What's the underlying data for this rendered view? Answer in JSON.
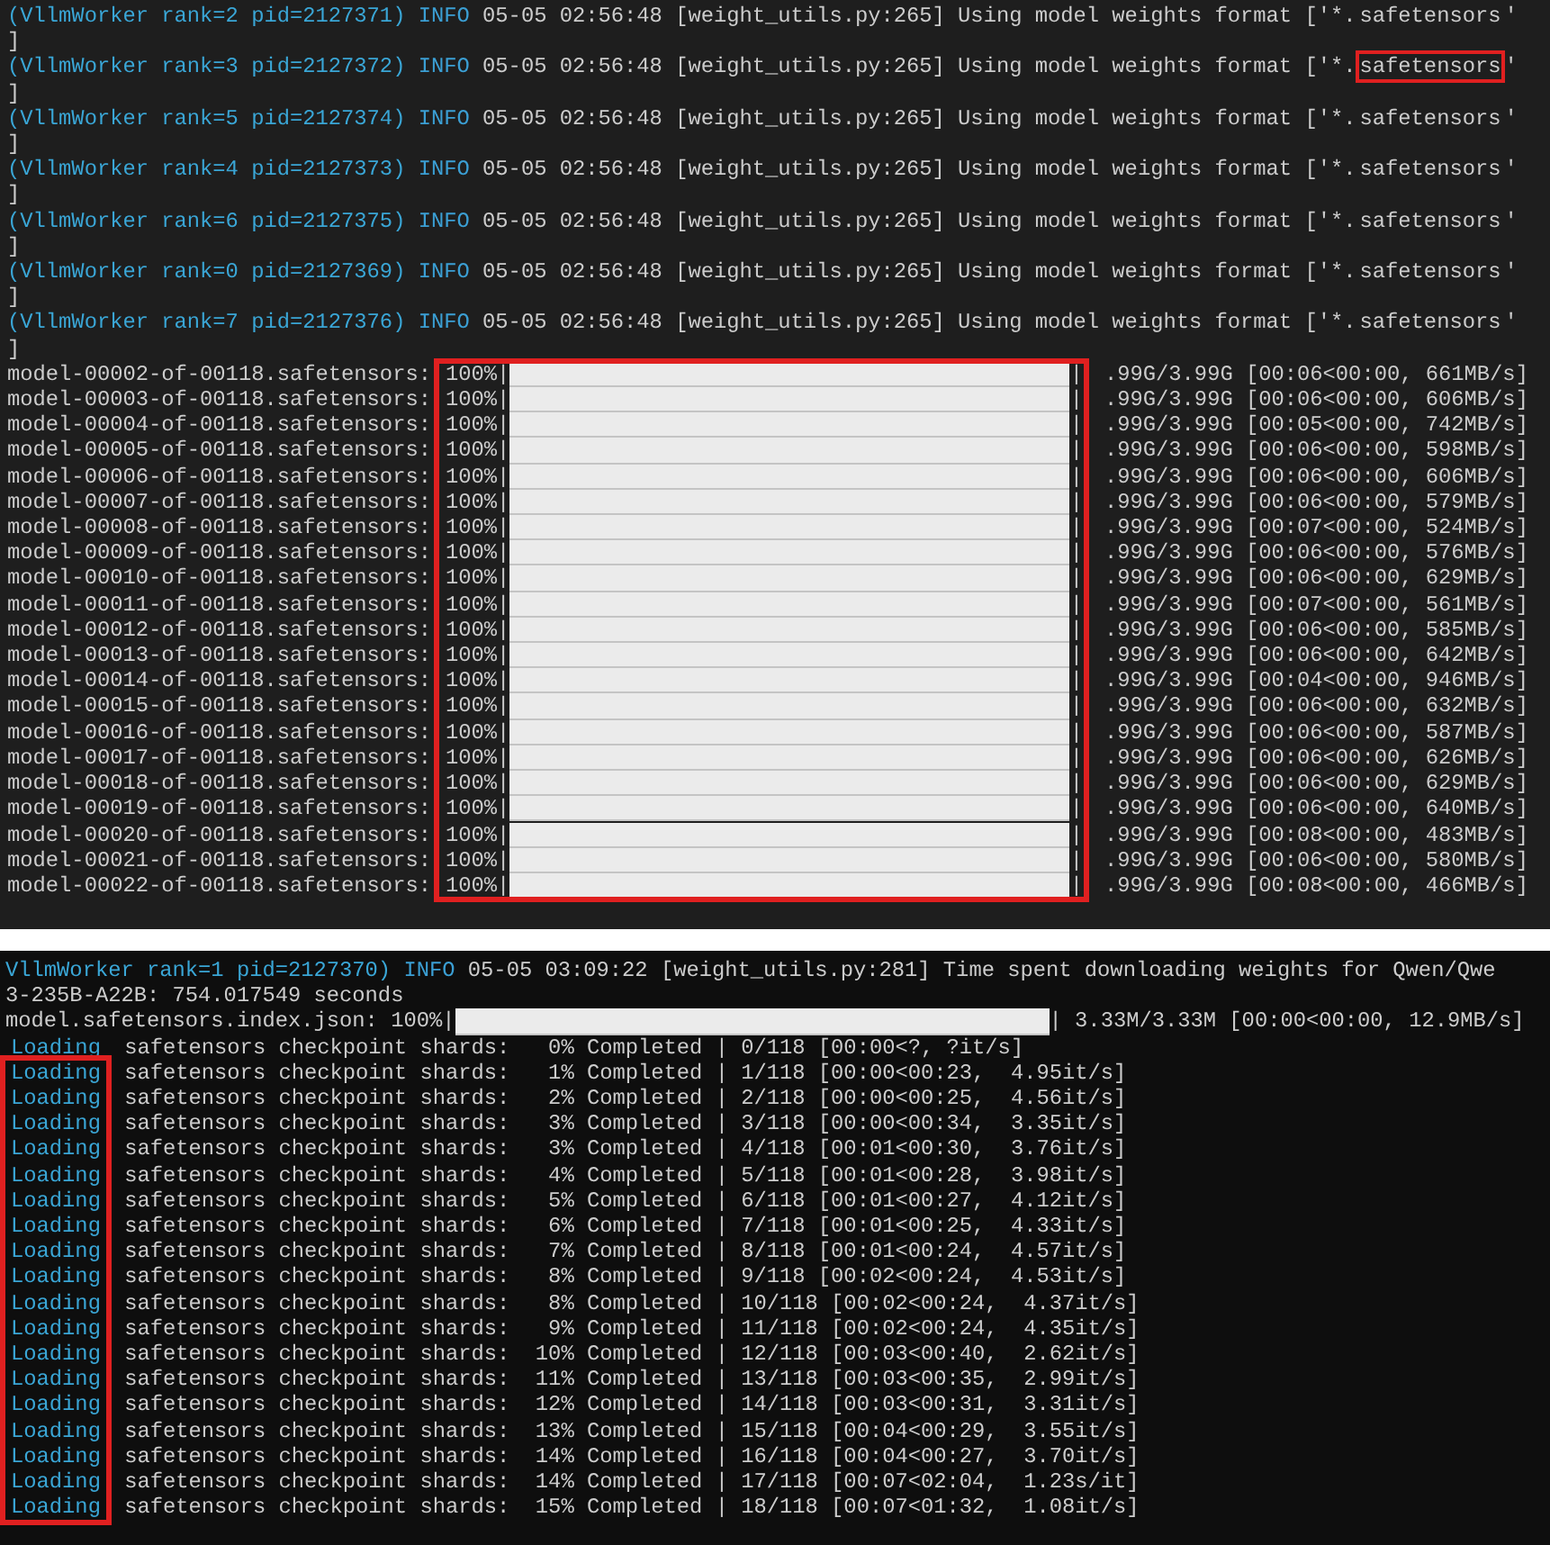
{
  "top_panel": {
    "log_lines": [
      {
        "worker": "(VllmWorker rank=2 pid=2127371)",
        "level": "INFO",
        "message": "05-05 02:56:48 [weight_utils.py:265] Using model weights format ['*.",
        "pattern": "safetensors",
        "tail": "'",
        "highlighted": false,
        "continuation": "]"
      },
      {
        "worker": "(VllmWorker rank=3 pid=2127372)",
        "level": "INFO",
        "message": "05-05 02:56:48 [weight_utils.py:265] Using model weights format ['*.",
        "pattern": "safetensors",
        "tail": "'",
        "highlighted": true,
        "continuation": "]"
      },
      {
        "worker": "(VllmWorker rank=5 pid=2127374)",
        "level": "INFO",
        "message": "05-05 02:56:48 [weight_utils.py:265] Using model weights format ['*.",
        "pattern": "safetensors",
        "tail": "'",
        "highlighted": false,
        "continuation": "]"
      },
      {
        "worker": "(VllmWorker rank=4 pid=2127373)",
        "level": "INFO",
        "message": "05-05 02:56:48 [weight_utils.py:265] Using model weights format ['*.",
        "pattern": "safetensors",
        "tail": "'",
        "highlighted": false,
        "continuation": "]"
      },
      {
        "worker": "(VllmWorker rank=6 pid=2127375)",
        "level": "INFO",
        "message": "05-05 02:56:48 [weight_utils.py:265] Using model weights format ['*.",
        "pattern": "safetensors",
        "tail": "'",
        "highlighted": false,
        "continuation": "]"
      },
      {
        "worker": "(VllmWorker rank=0 pid=2127369)",
        "level": "INFO",
        "message": "05-05 02:56:48 [weight_utils.py:265] Using model weights format ['*.",
        "pattern": "safetensors",
        "tail": "'",
        "highlighted": false,
        "continuation": "]"
      },
      {
        "worker": "(VllmWorker rank=7 pid=2127376)",
        "level": "INFO",
        "message": "05-05 02:56:48 [weight_utils.py:265] Using model weights format ['*.",
        "pattern": "safetensors",
        "tail": "'",
        "highlighted": false,
        "continuation": "]"
      }
    ],
    "downloads_highlighted": true,
    "downloads": [
      {
        "file": "model-00002-of-00118.safetensors:",
        "percent": "100%|",
        "level": 1,
        "end": "|",
        "stats": ".99G/3.99G [00:06<00:00, 661MB/s]"
      },
      {
        "file": "model-00003-of-00118.safetensors:",
        "percent": "100%|",
        "level": 1,
        "end": "|",
        "stats": ".99G/3.99G [00:06<00:00, 606MB/s]"
      },
      {
        "file": "model-00004-of-00118.safetensors:",
        "percent": "100%|",
        "level": 1,
        "end": "|",
        "stats": ".99G/3.99G [00:05<00:00, 742MB/s]"
      },
      {
        "file": "model-00005-of-00118.safetensors:",
        "percent": "100%|",
        "level": 1,
        "end": "|",
        "stats": ".99G/3.99G [00:06<00:00, 598MB/s]"
      },
      {
        "file": "model-00006-of-00118.safetensors:",
        "percent": "100%|",
        "level": 1,
        "end": "|",
        "stats": ".99G/3.99G [00:06<00:00, 606MB/s]"
      },
      {
        "file": "model-00007-of-00118.safetensors:",
        "percent": "100%|",
        "level": 1,
        "end": "|",
        "stats": ".99G/3.99G [00:06<00:00, 579MB/s]"
      },
      {
        "file": "model-00008-of-00118.safetensors:",
        "percent": "100%|",
        "level": 1,
        "end": "|",
        "stats": ".99G/3.99G [00:07<00:00, 524MB/s]"
      },
      {
        "file": "model-00009-of-00118.safetensors:",
        "percent": "100%|",
        "level": 1,
        "end": "|",
        "stats": ".99G/3.99G [00:06<00:00, 576MB/s]"
      },
      {
        "file": "model-00010-of-00118.safetensors:",
        "percent": "100%|",
        "level": 1,
        "end": "|",
        "stats": ".99G/3.99G [00:06<00:00, 629MB/s]"
      },
      {
        "file": "model-00011-of-00118.safetensors:",
        "percent": "100%|",
        "level": 1,
        "end": "|",
        "stats": ".99G/3.99G [00:07<00:00, 561MB/s]"
      },
      {
        "file": "model-00012-of-00118.safetensors:",
        "percent": "100%|",
        "level": 1,
        "end": "|",
        "stats": ".99G/3.99G [00:06<00:00, 585MB/s]"
      },
      {
        "file": "model-00013-of-00118.safetensors:",
        "percent": "100%|",
        "level": 1,
        "end": "|",
        "stats": ".99G/3.99G [00:06<00:00, 642MB/s]"
      },
      {
        "file": "model-00014-of-00118.safetensors:",
        "percent": "100%|",
        "level": 1,
        "end": "|",
        "stats": ".99G/3.99G [00:04<00:00, 946MB/s]"
      },
      {
        "file": "model-00015-of-00118.safetensors:",
        "percent": "100%|",
        "level": 1,
        "end": "|",
        "stats": ".99G/3.99G [00:06<00:00, 632MB/s]"
      },
      {
        "file": "model-00016-of-00118.safetensors:",
        "percent": "100%|",
        "level": 1,
        "end": "|",
        "stats": ".99G/3.99G [00:06<00:00, 587MB/s]"
      },
      {
        "file": "model-00017-of-00118.safetensors:",
        "percent": "100%|",
        "level": 1,
        "end": "|",
        "stats": ".99G/3.99G [00:06<00:00, 626MB/s]"
      },
      {
        "file": "model-00018-of-00118.safetensors:",
        "percent": "100%|",
        "level": 1,
        "end": "|",
        "stats": ".99G/3.99G [00:06<00:00, 629MB/s]"
      },
      {
        "file": "model-00019-of-00118.safetensors:",
        "percent": "100%|",
        "level": 1,
        "end": "|",
        "stats": ".99G/3.99G [00:06<00:00, 640MB/s]"
      },
      {
        "file": "model-00020-of-00118.safetensors:",
        "percent": "100%|",
        "level": 1,
        "end": "|",
        "stats": ".99G/3.99G [00:08<00:00, 483MB/s]"
      },
      {
        "file": "model-00021-of-00118.safetensors:",
        "percent": "100%|",
        "level": 1,
        "end": "|",
        "stats": ".99G/3.99G [00:06<00:00, 580MB/s]"
      },
      {
        "file": "model-00022-of-00118.safetensors:",
        "percent": "100%|",
        "level": 1,
        "end": "|",
        "stats": ".99G/3.99G [00:08<00:00, 466MB/s]"
      }
    ]
  },
  "bottom_panel": {
    "header": {
      "worker": "VllmWorker rank=1 pid=2127370)",
      "level": "INFO",
      "message": "05-05 03:09:22 [weight_utils.py:281] Time spent downloading weights for Qwen/Qwe"
    },
    "duration": "3-235B-A22B: 754.017549 seconds",
    "index_download": {
      "file": "model.safetensors.index.json:",
      "percent": "100%|",
      "level": 1,
      "end": "|",
      "stats": "3.33M/3.33M [00:00<00:00, 12.9MB/s]"
    },
    "loading_lines": [
      {
        "prefix": "Loading",
        "text": "safetensors checkpoint shards:   0% Completed | 0/118 [00:00<?, ?it/s]",
        "highlighted": false
      },
      {
        "prefix": "Loading",
        "text": "safetensors checkpoint shards:   1% Completed | 1/118 [00:00<00:23,  4.95it/s]",
        "highlighted": true
      },
      {
        "prefix": "Loading",
        "text": "safetensors checkpoint shards:   2% Completed | 2/118 [00:00<00:25,  4.56it/s]",
        "highlighted": true
      },
      {
        "prefix": "Loading",
        "text": "safetensors checkpoint shards:   3% Completed | 3/118 [00:00<00:34,  3.35it/s]",
        "highlighted": true
      },
      {
        "prefix": "Loading",
        "text": "safetensors checkpoint shards:   3% Completed | 4/118 [00:01<00:30,  3.76it/s]",
        "highlighted": true
      },
      {
        "prefix": "Loading",
        "text": "safetensors checkpoint shards:   4% Completed | 5/118 [00:01<00:28,  3.98it/s]",
        "highlighted": true
      },
      {
        "prefix": "Loading",
        "text": "safetensors checkpoint shards:   5% Completed | 6/118 [00:01<00:27,  4.12it/s]",
        "highlighted": true
      },
      {
        "prefix": "Loading",
        "text": "safetensors checkpoint shards:   6% Completed | 7/118 [00:01<00:25,  4.33it/s]",
        "highlighted": true
      },
      {
        "prefix": "Loading",
        "text": "safetensors checkpoint shards:   7% Completed | 8/118 [00:01<00:24,  4.57it/s]",
        "highlighted": true
      },
      {
        "prefix": "Loading",
        "text": "safetensors checkpoint shards:   8% Completed | 9/118 [00:02<00:24,  4.53it/s]",
        "highlighted": true
      },
      {
        "prefix": "Loading",
        "text": "safetensors checkpoint shards:   8% Completed | 10/118 [00:02<00:24,  4.37it/s]",
        "highlighted": true
      },
      {
        "prefix": "Loading",
        "text": "safetensors checkpoint shards:   9% Completed | 11/118 [00:02<00:24,  4.35it/s]",
        "highlighted": true
      },
      {
        "prefix": "Loading",
        "text": "safetensors checkpoint shards:  10% Completed | 12/118 [00:03<00:40,  2.62it/s]",
        "highlighted": true
      },
      {
        "prefix": "Loading",
        "text": "safetensors checkpoint shards:  11% Completed | 13/118 [00:03<00:35,  2.99it/s]",
        "highlighted": true
      },
      {
        "prefix": "Loading",
        "text": "safetensors checkpoint shards:  12% Completed | 14/118 [00:03<00:31,  3.31it/s]",
        "highlighted": true
      },
      {
        "prefix": "Loading",
        "text": "safetensors checkpoint shards:  13% Completed | 15/118 [00:04<00:29,  3.55it/s]",
        "highlighted": true
      },
      {
        "prefix": "Loading",
        "text": "safetensors checkpoint shards:  14% Completed | 16/118 [00:04<00:27,  3.70it/s]",
        "highlighted": true
      },
      {
        "prefix": "Loading",
        "text": "safetensors checkpoint shards:  14% Completed | 17/118 [00:07<02:04,  1.23s/it]",
        "highlighted": true
      },
      {
        "prefix": "Loading",
        "text": "safetensors checkpoint shards:  15% Completed | 18/118 [00:07<01:32,  1.08it/s]",
        "highlighted": true
      }
    ]
  }
}
